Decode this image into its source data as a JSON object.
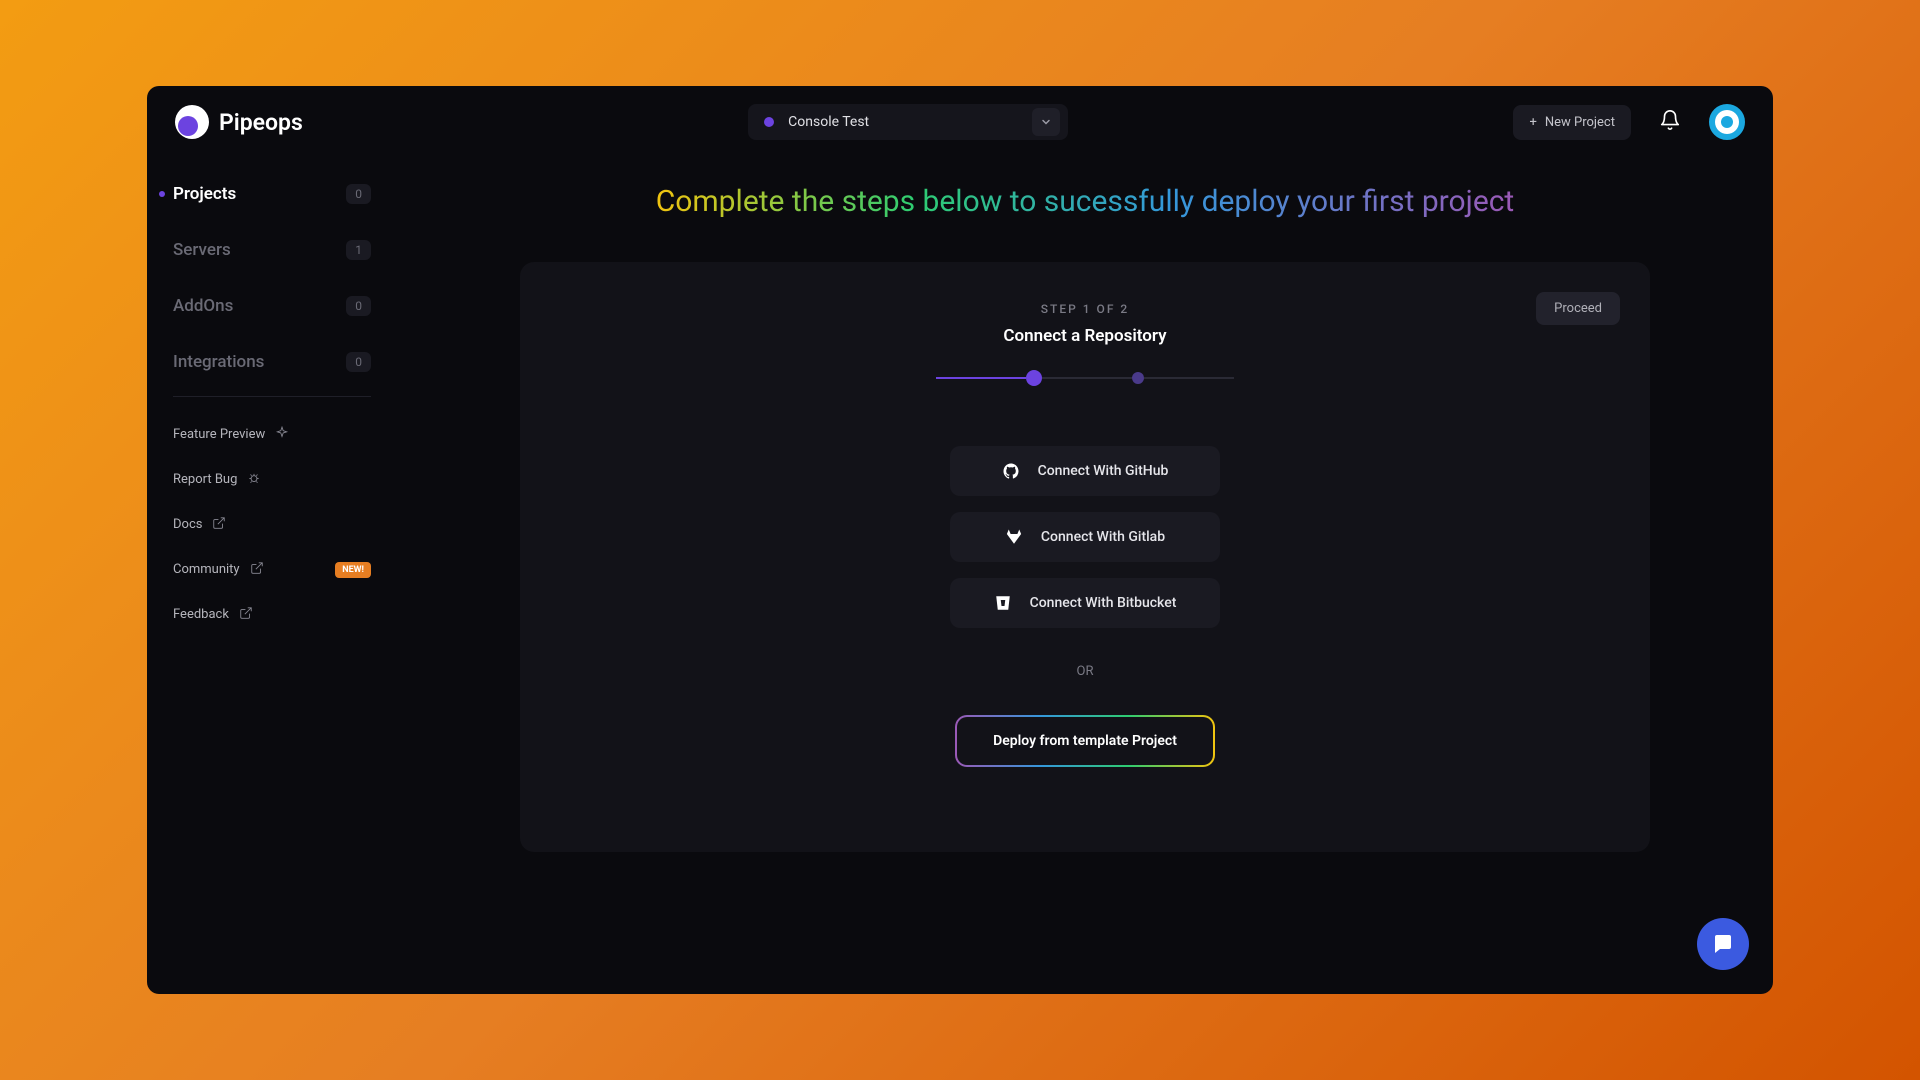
{
  "brand": {
    "name": "Pipeops"
  },
  "header": {
    "console_label": "Console Test",
    "new_project": "New Project"
  },
  "sidebar": {
    "nav": [
      {
        "label": "Projects",
        "count": "0",
        "active": true
      },
      {
        "label": "Servers",
        "count": "1",
        "active": false
      },
      {
        "label": "AddOns",
        "count": "0",
        "active": false
      },
      {
        "label": "Integrations",
        "count": "0",
        "active": false
      }
    ],
    "links": [
      {
        "label": "Feature Preview",
        "icon": "sparkle"
      },
      {
        "label": "Report Bug",
        "icon": "bug"
      },
      {
        "label": "Docs",
        "icon": "external"
      },
      {
        "label": "Community",
        "icon": "external",
        "badge": "NEW!"
      },
      {
        "label": "Feedback",
        "icon": "external"
      }
    ]
  },
  "main": {
    "hero": "Complete the steps below to sucessfully deploy your first project",
    "proceed": "Proceed",
    "step_label": "STEP 1 OF 2",
    "step_title": "Connect a Repository",
    "connect": [
      {
        "label": "Connect With GitHub",
        "provider": "github"
      },
      {
        "label": "Connect With Gitlab",
        "provider": "gitlab"
      },
      {
        "label": "Connect With Bitbucket",
        "provider": "bitbucket"
      }
    ],
    "or": "OR",
    "template": "Deploy from template Project"
  },
  "colors": {
    "accent": "#6c43e0"
  }
}
